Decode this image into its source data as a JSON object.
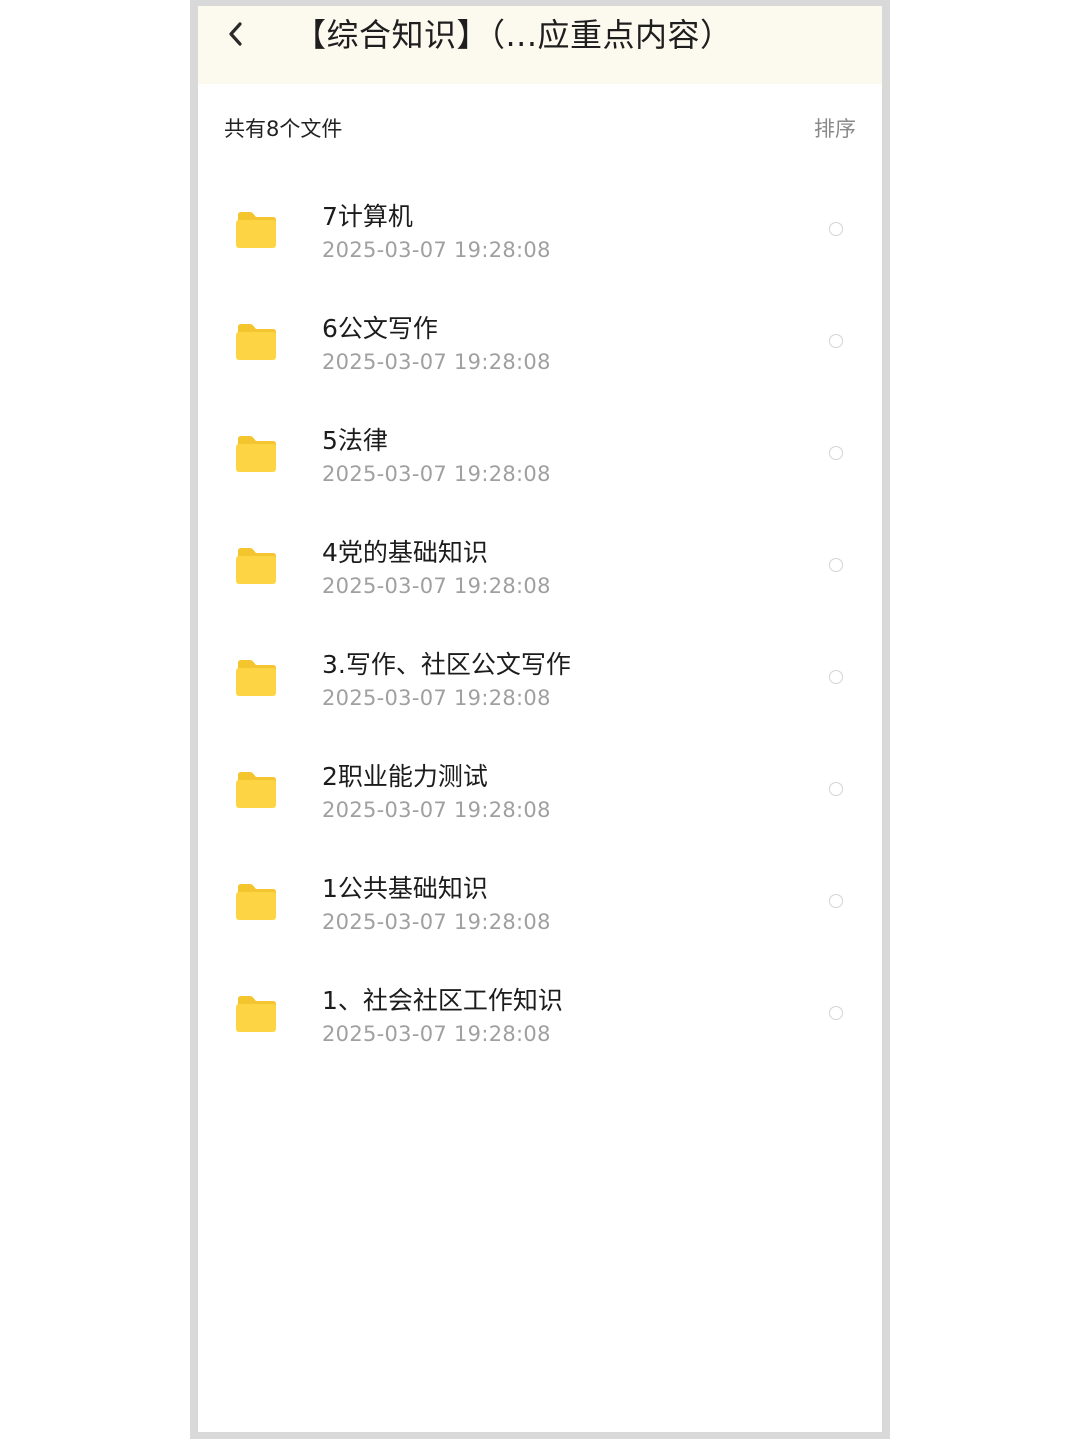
{
  "header": {
    "title": "【综合知识】（...应重点内容）",
    "back_icon": "chevron-left-icon"
  },
  "toolbar": {
    "count_label": "共有8个文件",
    "sort_label": "排序"
  },
  "files": [
    {
      "name": "7计算机",
      "time": "2025-03-07  19:28:08",
      "icon": "folder-icon"
    },
    {
      "name": "6公文写作",
      "time": "2025-03-07  19:28:08",
      "icon": "folder-icon"
    },
    {
      "name": "5法律",
      "time": "2025-03-07  19:28:08",
      "icon": "folder-icon"
    },
    {
      "name": "4党的基础知识",
      "time": "2025-03-07  19:28:08",
      "icon": "folder-icon"
    },
    {
      "name": "3.写作、社区公文写作",
      "time": "2025-03-07  19:28:08",
      "icon": "folder-icon"
    },
    {
      "name": "2职业能力测试",
      "time": "2025-03-07  19:28:08",
      "icon": "folder-icon"
    },
    {
      "name": "1公共基础知识",
      "time": "2025-03-07  19:28:08",
      "icon": "folder-icon"
    },
    {
      "name": "1、社会社区工作知识",
      "time": "2025-03-07  19:28:08",
      "icon": "folder-icon"
    }
  ],
  "colors": {
    "header_bg": "#fcf9ef",
    "folder": "#fdd443",
    "folder_tab": "#f5c530",
    "text_primary": "#1c1c1c",
    "text_secondary": "#a0a0a0"
  }
}
